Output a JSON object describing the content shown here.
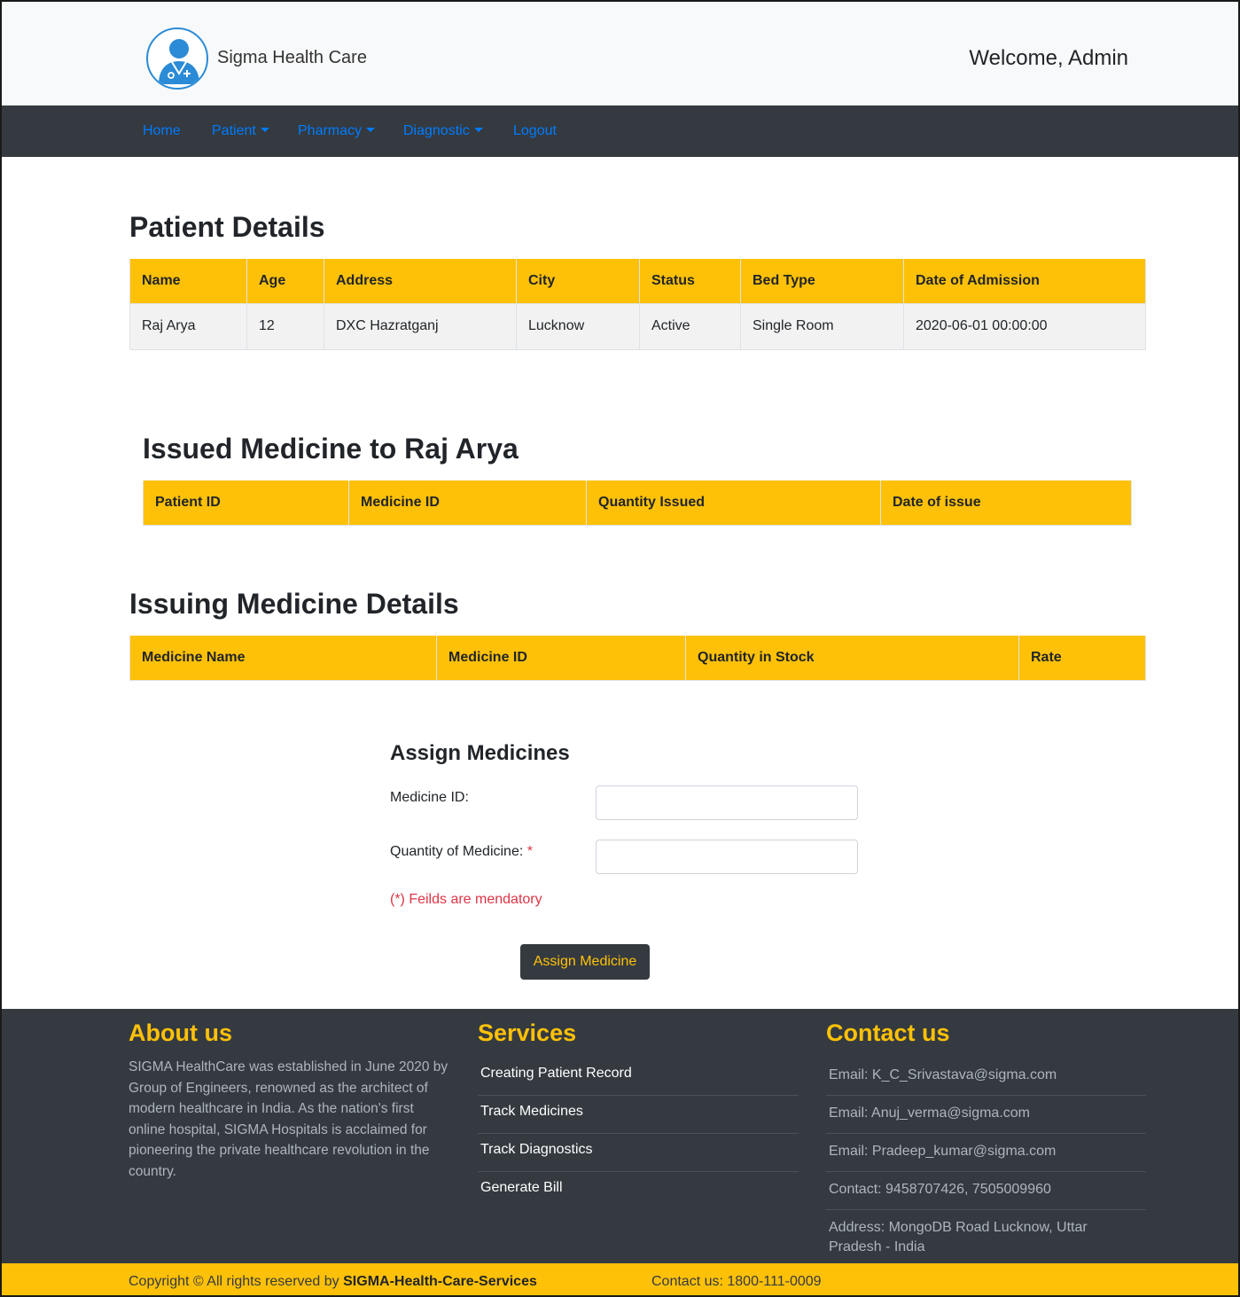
{
  "header": {
    "brand": "Sigma Health Care",
    "welcome": "Welcome, Admin"
  },
  "nav": {
    "home": "Home",
    "patient": "Patient",
    "pharmacy": "Pharmacy",
    "diagnostic": "Diagnostic",
    "logout": "Logout"
  },
  "patient_details": {
    "title": "Patient Details",
    "columns": [
      "Name",
      "Age",
      "Address",
      "City",
      "Status",
      "Bed Type",
      "Date of Admission"
    ],
    "rows": [
      [
        "Raj Arya",
        "12",
        "DXC Hazratganj",
        "Lucknow",
        "Active",
        "Single Room",
        "2020-06-01 00:00:00"
      ]
    ]
  },
  "issued_medicine": {
    "title": "Issued Medicine to Raj Arya",
    "columns": [
      "Patient ID",
      "Medicine ID",
      "Quantity Issued",
      "Date of issue"
    ]
  },
  "issuing_details": {
    "title": "Issuing Medicine Details",
    "columns": [
      "Medicine Name",
      "Medicine ID",
      "Quantity in Stock",
      "Rate"
    ]
  },
  "assign_form": {
    "title": "Assign Medicines",
    "medicine_id_label": "Medicine ID:",
    "medicine_id_value": "",
    "quantity_label": "Quantity of Medicine:",
    "quantity_value": "",
    "required_mark": "*",
    "mandatory_note": "(*) Feilds are mendatory",
    "submit_label": "Assign Medicine"
  },
  "footer": {
    "about_title": "About us",
    "about_text": "SIGMA HealthCare was established in June 2020 by Group of Engineers, renowned as the architect of modern healthcare in India. As the nation's first online hospital, SIGMA Hospitals is acclaimed for pioneering the private healthcare revolution in the country.",
    "services_title": "Services",
    "services": [
      "Creating Patient Record",
      "Track Medicines",
      "Track Diagnostics",
      "Generate Bill"
    ],
    "contact_title": "Contact us",
    "contacts": [
      "Email: K_C_Srivastava@sigma.com",
      "Email: Anuj_verma@sigma.com",
      "Email: Pradeep_kumar@sigma.com",
      "Contact: 9458707426, 7505009960",
      "Address: MongoDB Road Lucknow, Uttar Pradesh - India"
    ],
    "copyright_prefix": "Copyright © All rights reserved by",
    "copyright_org": "SIGMA-Health-Care-Services",
    "hotline": "Contact us: 1800-111-0009"
  },
  "colors": {
    "accent": "#ffc107",
    "dark": "#343a40",
    "link": "#007bff",
    "danger": "#dc3545"
  },
  "icons": {
    "logo": "doctor-avatar-icon",
    "dropdown": "caret-down-icon"
  }
}
